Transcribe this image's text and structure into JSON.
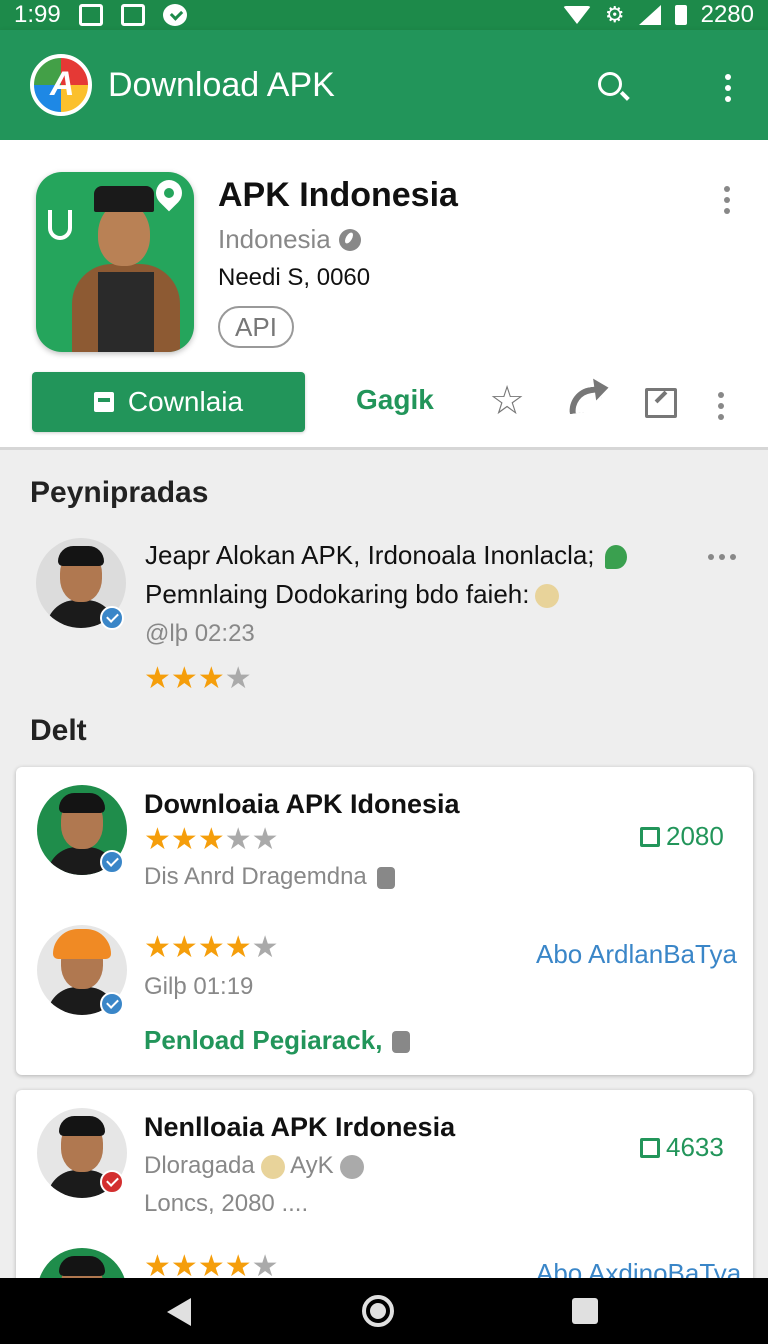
{
  "status_bar": {
    "time": "1:99",
    "battery": "2280"
  },
  "app_bar": {
    "title": "Download APK"
  },
  "app": {
    "name": "APK Indonesia",
    "developer": "Indonesia",
    "date": "Needi S, 0060",
    "chip": "API",
    "download_label": "Cownlaia",
    "secondary_label": "Gagik"
  },
  "reviews_section": {
    "title": "Peynipradas",
    "review": {
      "line1": "Jeapr Alokan APK, Irdonoala Inonlacla;",
      "line2": "Pemnlaing Dodokaring bdo faieh:",
      "meta": "@lþ 02:23",
      "rating": 3,
      "rating_max": 4
    }
  },
  "details_section": {
    "title": "Delt",
    "card1": {
      "item1": {
        "title": "Downloaia APK Idonesia",
        "rating": 3,
        "rating_max": 5,
        "subtitle": "Dis Anrd Dragemdna",
        "count": "2080"
      },
      "item2": {
        "rating": 4,
        "rating_max": 5,
        "meta": "Gilþ 01:19",
        "link": "Abo ArdlanBaTya",
        "action": "Penload Pegiarack,"
      }
    },
    "card2": {
      "item1": {
        "title": "Nenlloaia APK Irdonesia",
        "subtitle": "Dloragada",
        "subtitle_suffix": "AyK",
        "meta": "Loncs, 2080 ....",
        "count": "4633"
      },
      "item2": {
        "rating": 4,
        "rating_max": 5,
        "link": "Abo AxdinoBaTya"
      }
    }
  },
  "colors": {
    "primary": "#22955a",
    "status_bar": "#1d8a4a",
    "star": "#f59e0b",
    "link": "#3a86c8"
  }
}
